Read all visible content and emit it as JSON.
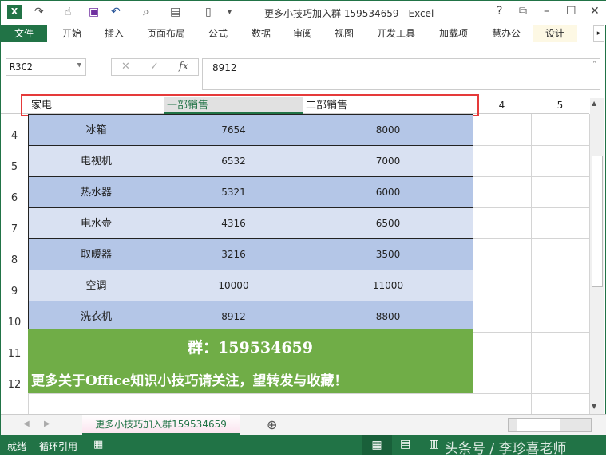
{
  "window": {
    "title": "更多小技巧加入群 159534659  -  Excel",
    "help": "?",
    "restore_ribbon": "⧉",
    "minimize": "–",
    "maximize": "☐",
    "close": "✕"
  },
  "ribbon": {
    "tabs": [
      "文件",
      "开始",
      "插入",
      "页面布局",
      "公式",
      "数据",
      "审阅",
      "视图",
      "开发工具",
      "加载项",
      "慧办公",
      "设计"
    ]
  },
  "formula_bar": {
    "name_box": "R3C2",
    "cancel": "✕",
    "enter": "✓",
    "fx": "fx",
    "value": "8912"
  },
  "columns": [
    "家电",
    "一部销售",
    "二部销售",
    "4",
    "5"
  ],
  "rows": [
    {
      "num": "4",
      "item": "冰箱",
      "dept1": "7654",
      "dept2": "8000"
    },
    {
      "num": "5",
      "item": "电视机",
      "dept1": "6532",
      "dept2": "7000"
    },
    {
      "num": "6",
      "item": "热水器",
      "dept1": "5321",
      "dept2": "6000"
    },
    {
      "num": "7",
      "item": "电水壶",
      "dept1": "4316",
      "dept2": "6500"
    },
    {
      "num": "8",
      "item": "取暖器",
      "dept1": "3216",
      "dept2": "3500"
    },
    {
      "num": "9",
      "item": "空调",
      "dept1": "10000",
      "dept2": "11000"
    },
    {
      "num": "10",
      "item": "洗衣机",
      "dept1": "8912",
      "dept2": "8800"
    }
  ],
  "banner": {
    "row11": "11",
    "row12": "12",
    "line1": "群：159534659",
    "line2": "更多关于Office知识小技巧请关注，望转发与收藏！"
  },
  "sheet": {
    "tab": "更多小技巧加入群159534659",
    "add": "⊕"
  },
  "status": {
    "ready": "就绪",
    "circular": "循环引用",
    "watermark": "头条号 / 李珍喜老师"
  },
  "colors": {
    "accent": "#217346",
    "row_dark": "#b4c6e7",
    "row_light": "#d9e1f2",
    "banner": "#70ad47"
  }
}
